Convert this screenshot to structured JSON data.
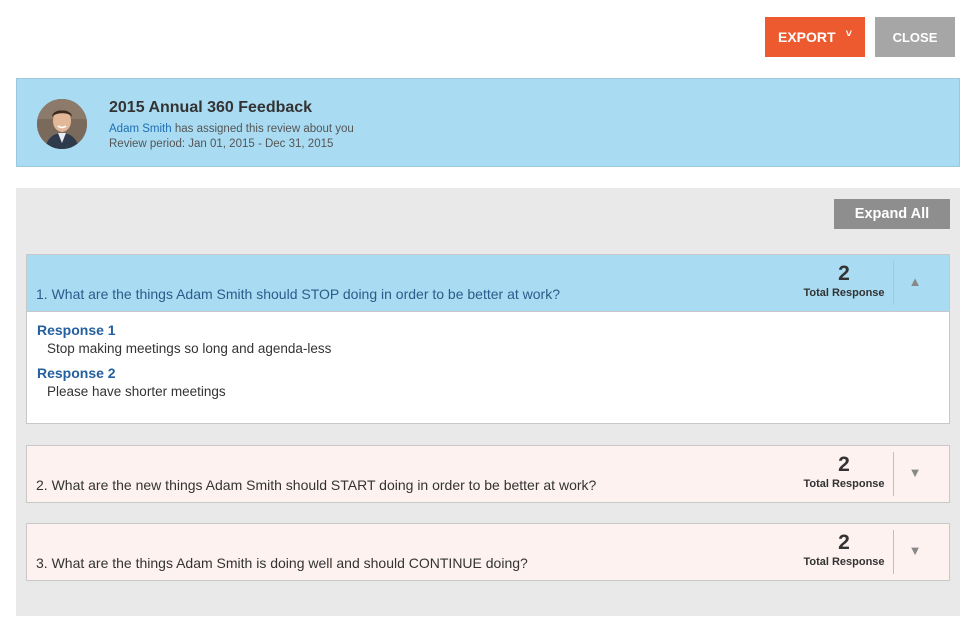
{
  "toolbar": {
    "export_label": "EXPORT",
    "export_chevron": "˅",
    "close_label": "CLOSE",
    "export_color": "#ee5a2f",
    "close_color": "#a6a6a6"
  },
  "review": {
    "title": "2015 Annual 360 Feedback",
    "assigner": "Adam Smith",
    "assign_suffix": " has assigned this review about you",
    "period": "Review period: Jan 01, 2015 - Dec 31, 2015",
    "header_color": "#a9dcf2"
  },
  "panel": {
    "expand_label": "Expand All"
  },
  "questions": [
    {
      "text": "1. What are the things Adam Smith should STOP doing in order to be better at work?",
      "count": "2",
      "count_label": "Total Response",
      "toggle": "▲",
      "expanded": true,
      "responses": [
        {
          "label": "Response 1",
          "text": "Stop making meetings so long and agenda-less"
        },
        {
          "label": "Response 2",
          "text": "Please have shorter meetings"
        }
      ]
    },
    {
      "text": "2. What are the new things Adam Smith should START doing in order to be better at work?",
      "count": "2",
      "count_label": "Total Response",
      "toggle": "▼",
      "expanded": false
    },
    {
      "text": "3. What are the things Adam Smith is doing well and should CONTINUE doing?",
      "count": "2",
      "count_label": "Total Response",
      "toggle": "▼",
      "expanded": false
    }
  ]
}
